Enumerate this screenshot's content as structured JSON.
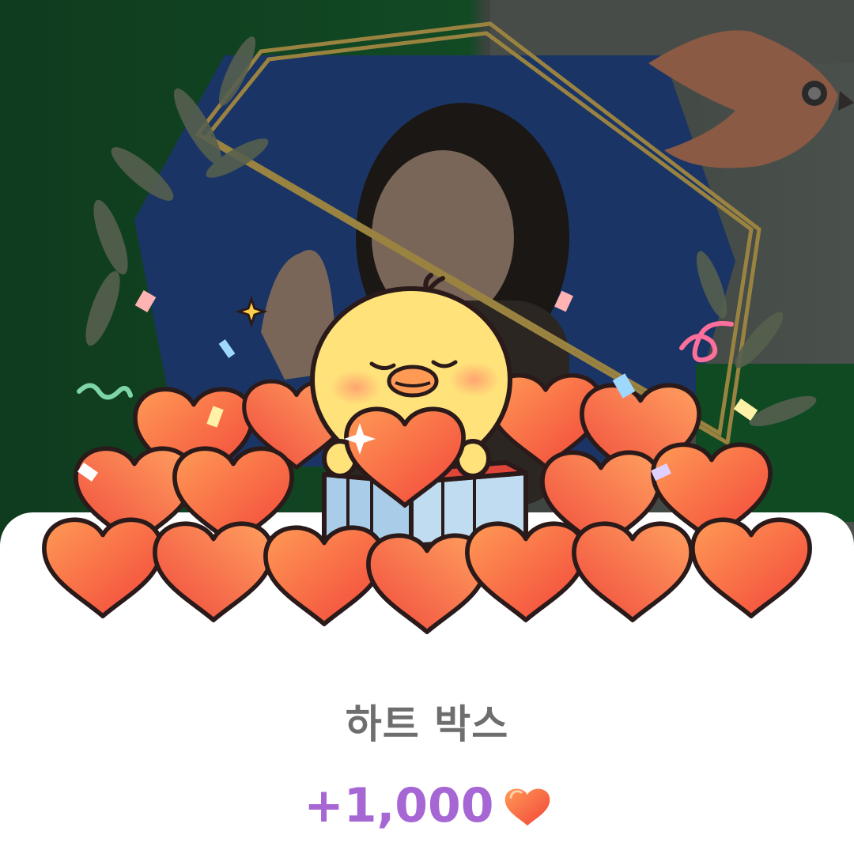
{
  "popup": {
    "title": "하트 박스",
    "reward_amount": "+1,000",
    "reward_icon": "heart-icon"
  },
  "colors": {
    "title": "#6e6e6e",
    "reward": "#a667d4",
    "heart_light": "#ff9a55",
    "heart_dark": "#f2453a",
    "chick": "#ffe27a",
    "card": "#ffffff"
  }
}
